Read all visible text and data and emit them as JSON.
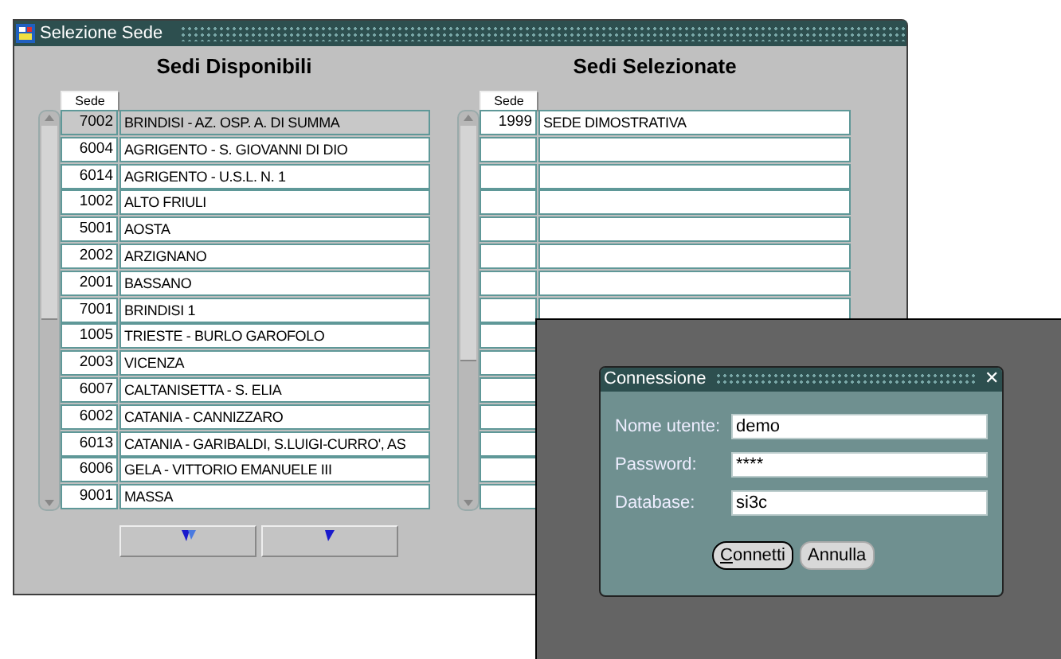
{
  "window": {
    "title": "Selezione Sede"
  },
  "available": {
    "heading": "Sedi Disponibili",
    "column": "Sede",
    "rows": [
      {
        "code": "7002",
        "name": "BRINDISI - AZ. OSP. A. DI SUMMA",
        "selected": true
      },
      {
        "code": "6004",
        "name": "AGRIGENTO - S. GIOVANNI DI DIO",
        "selected": false
      },
      {
        "code": "6014",
        "name": "AGRIGENTO - U.S.L. N. 1",
        "selected": false
      },
      {
        "code": "1002",
        "name": "ALTO FRIULI",
        "selected": false
      },
      {
        "code": "5001",
        "name": "AOSTA",
        "selected": false
      },
      {
        "code": "2002",
        "name": "ARZIGNANO",
        "selected": false
      },
      {
        "code": "2001",
        "name": "BASSANO",
        "selected": false
      },
      {
        "code": "7001",
        "name": "BRINDISI 1",
        "selected": false
      },
      {
        "code": "1005",
        "name": "TRIESTE - BURLO GAROFOLO",
        "selected": false
      },
      {
        "code": "2003",
        "name": "VICENZA",
        "selected": false
      },
      {
        "code": "6007",
        "name": "CALTANISETTA - S. ELIA",
        "selected": false
      },
      {
        "code": "6002",
        "name": "CATANIA - CANNIZZARO",
        "selected": false
      },
      {
        "code": "6013",
        "name": "CATANIA - GARIBALDI, S.LUIGI-CURRO', AS",
        "selected": false
      },
      {
        "code": "6006",
        "name": "GELA - VITTORIO EMANUELE III",
        "selected": false
      },
      {
        "code": "9001",
        "name": "MASSA",
        "selected": false
      }
    ]
  },
  "selected_list": {
    "heading": "Sedi Selezionate",
    "column": "Sede",
    "rows": [
      {
        "code": "1999",
        "name": "SEDE DIMOSTRATIVA",
        "selected": false
      }
    ]
  },
  "dialog": {
    "title": "Connessione",
    "close": "✕",
    "fields": [
      {
        "label": "Nome utente:",
        "value": "demo"
      },
      {
        "label": "Password:",
        "value": "****"
      },
      {
        "label": "Database:",
        "value": "si3c"
      }
    ],
    "buttons": [
      {
        "label": "Connetti",
        "focused": true,
        "mnemonic": true
      },
      {
        "label": "Annulla",
        "focused": false,
        "mnemonic": false
      }
    ]
  }
}
